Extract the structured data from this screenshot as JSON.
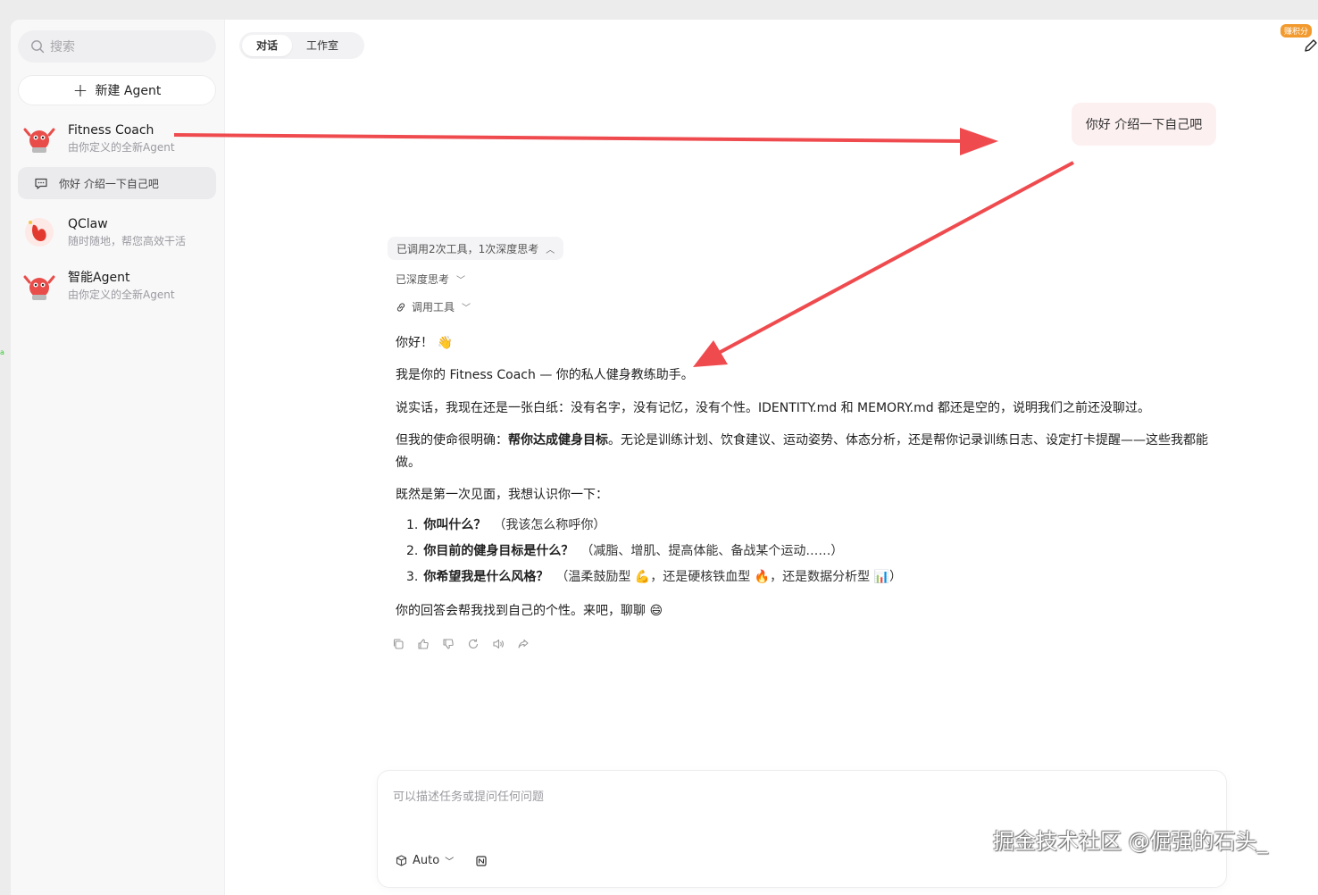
{
  "sidebar": {
    "search_placeholder": "搜索",
    "new_agent_label": "新建 Agent",
    "agents": [
      {
        "name": "Fitness Coach",
        "desc": "由你定义的全新Agent"
      },
      {
        "name": "QClaw",
        "desc": "随时随地，帮您高效干活"
      },
      {
        "name": "智能Agent",
        "desc": "由你定义的全新Agent"
      }
    ],
    "active_chat": "你好 介绍一下自己吧"
  },
  "header": {
    "tabs": [
      {
        "label": "对话",
        "active": true
      },
      {
        "label": "工作室",
        "active": false
      }
    ],
    "points_badge": "赚积分"
  },
  "conversation": {
    "user_message": "你好 介绍一下自己吧",
    "tool_summary": "已调用2次工具，1次深度思考",
    "deep_thinking": "已深度思考",
    "tool_call": "调用工具",
    "reply": {
      "greeting": "你好！",
      "greeting_emoji": "👋",
      "intro": "我是你的 Fitness Coach — 你的私人健身教练助手。",
      "p1": "说实话，我现在还是一张白纸：没有名字，没有记忆，没有个性。IDENTITY.md 和 MEMORY.md 都还是空的，说明我们之前还没聊过。",
      "p2_prefix": "但我的使命很明确：",
      "p2_bold": "帮你达成健身目标",
      "p2_suffix": "。无论是训练计划、饮食建议、运动姿势、体态分析，还是帮你记录训练日志、设定打卡提醒——这些我都能做。",
      "p3": "既然是第一次见面，我想认识你一下：",
      "questions": [
        {
          "num": "1.",
          "q": "你叫什么？",
          "sub": "（我该怎么称呼你）"
        },
        {
          "num": "2.",
          "q": "你目前的健身目标是什么？",
          "sub": "（减脂、增肌、提高体能、备战某个运动……）"
        },
        {
          "num": "3.",
          "q": "你希望我是什么风格？",
          "sub": "（温柔鼓励型 💪，还是硬核铁血型 🔥，还是数据分析型 📊）"
        }
      ],
      "closing": "你的回答会帮我找到自己的个性。来吧，聊聊 😄"
    }
  },
  "composer": {
    "placeholder": "可以描述任务或提问任何问题",
    "model_label": "Auto"
  },
  "watermark": "掘金技术社区 @倔强的石头_",
  "colors": {
    "arrow": "#ef4b4f",
    "user_bubble": "#fdf0f1",
    "badge": "#f29a2e"
  }
}
